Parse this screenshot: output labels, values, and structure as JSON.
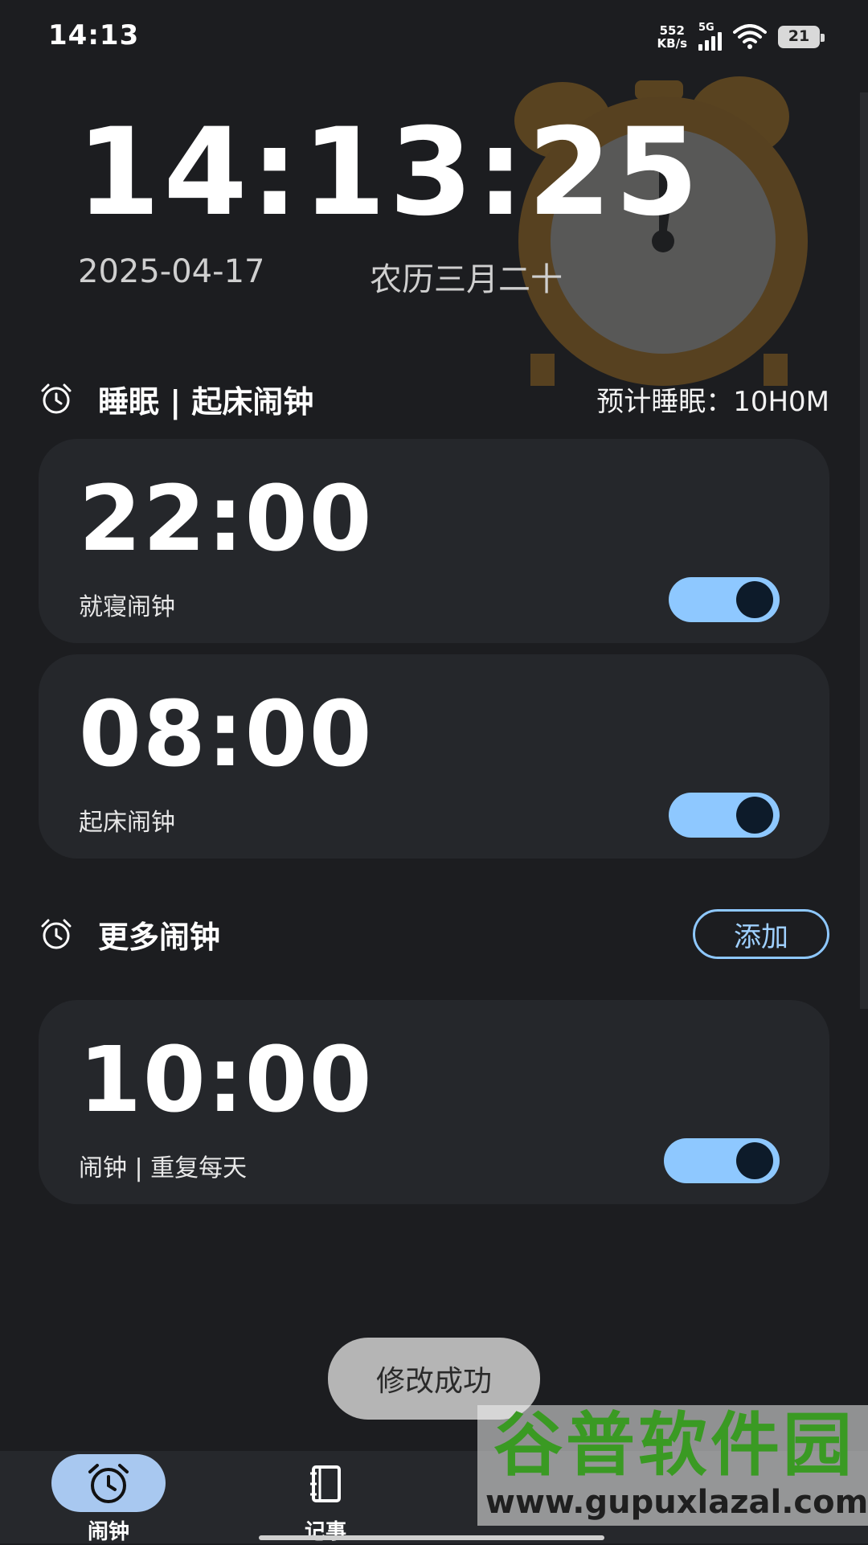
{
  "status_bar": {
    "time": "14:13",
    "net_speed_value": "552",
    "net_speed_unit": "KB/s",
    "network_type": "5G",
    "battery": "21"
  },
  "hero": {
    "time": "14:13:25",
    "date": "2025-04-17",
    "lunar_date": "农历三月二十"
  },
  "sleep_section": {
    "title": "睡眠 | 起床闹钟",
    "estimate": "预计睡眠：10H0M",
    "alarms": [
      {
        "time": "22:00",
        "label": "就寝闹钟",
        "enabled": true
      },
      {
        "time": "08:00",
        "label": "起床闹钟",
        "enabled": true
      }
    ]
  },
  "more_section": {
    "title": "更多闹钟",
    "add_label": "添加",
    "alarms": [
      {
        "time": "10:00",
        "label": "闹钟 | 重复每天",
        "enabled": true
      }
    ]
  },
  "toast": "修改成功",
  "bottom_nav": {
    "items": [
      {
        "label": "闹钟",
        "icon": "alarm-clock-icon",
        "active": true
      },
      {
        "label": "记事",
        "icon": "notebook-icon",
        "active": false
      }
    ]
  },
  "watermark": {
    "name": "谷普软件园",
    "url": "www.gupuxlazal.com"
  },
  "colors": {
    "background": "#1c1d20",
    "card": "#25272b",
    "accent": "#8ec8ff",
    "nav_active": "#a8c8f0"
  }
}
